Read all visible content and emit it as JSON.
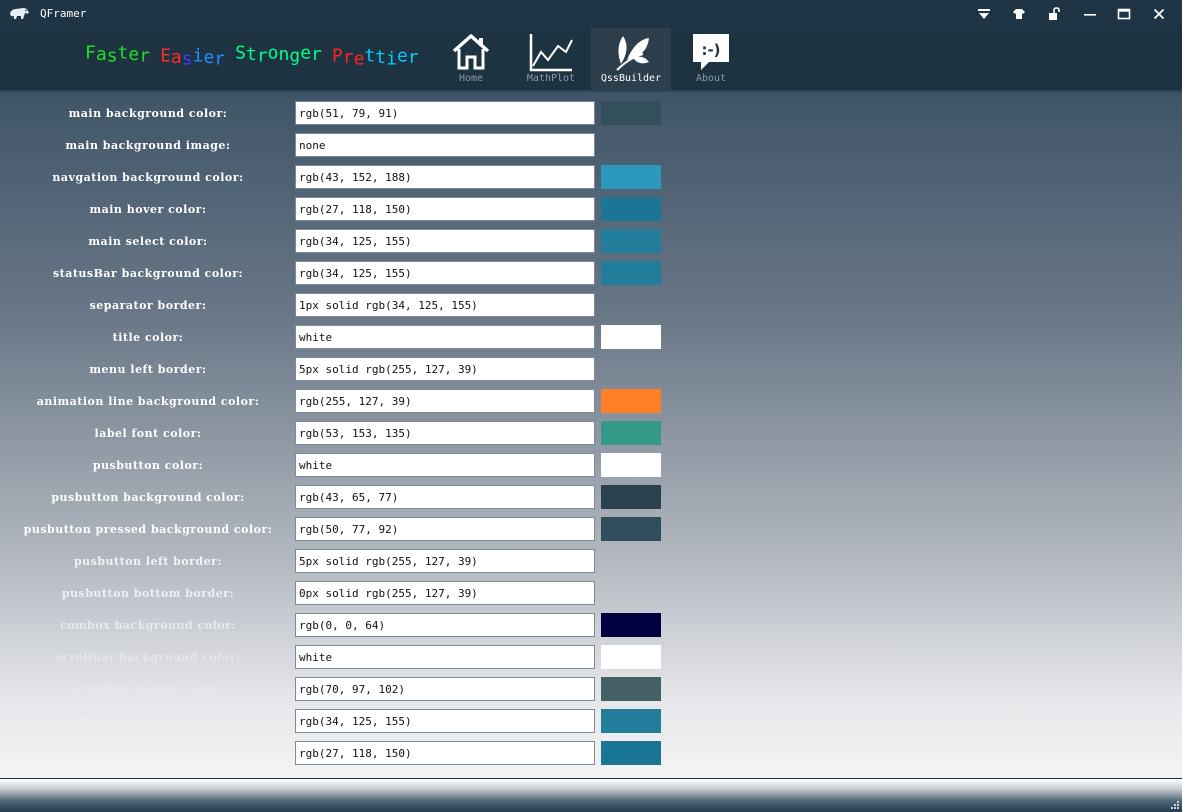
{
  "window": {
    "title": "QFramer",
    "controls": [
      {
        "name": "dropdown-icon",
        "glyph": "▼"
      },
      {
        "name": "skin-shirt-icon",
        "glyph": "shirt"
      },
      {
        "name": "lock-open-icon",
        "glyph": "lock"
      },
      {
        "name": "minimize-icon",
        "glyph": "—"
      },
      {
        "name": "maximize-icon",
        "glyph": "☐"
      },
      {
        "name": "close-icon",
        "glyph": "✕"
      }
    ]
  },
  "slogan": {
    "words": [
      {
        "text": "Faster",
        "colors": [
          "#22dd22"
        ]
      },
      {
        "text": "Easier",
        "colors": [
          "#ff2a2a",
          "#ff2a2a",
          "#3b3bff",
          "#1e90ff",
          "#1e90ff",
          "#1e90ff"
        ]
      },
      {
        "text": "Stronger",
        "colors": [
          "#00ff88"
        ]
      },
      {
        "text": "Prettier",
        "colors": [
          "#ff2222",
          "#ff2222",
          "#ff2222",
          "#00ccff",
          "#00ccff",
          "#00ccff",
          "#00ccff",
          "#00ccff"
        ]
      }
    ]
  },
  "nav": {
    "items": [
      {
        "label": "Home",
        "icon": "home-icon",
        "active": false
      },
      {
        "label": "MathPlot",
        "icon": "line-chart-icon",
        "active": false
      },
      {
        "label": "QssBuilder",
        "icon": "leaf-icon",
        "active": true
      },
      {
        "label": "About",
        "icon": "smiley-bubble-icon",
        "active": false
      }
    ]
  },
  "rows": [
    {
      "label": "main background color:",
      "value": "rgb(51, 79, 91)",
      "swatch": "#334f5b",
      "label_color": "#ffffff"
    },
    {
      "label": "main background image:",
      "value": "none",
      "swatch": null,
      "label_color": "#ffffff"
    },
    {
      "label": "navgation background color:",
      "value": "rgb(43, 152, 188)",
      "swatch": "#2b98bc",
      "label_color": "#ffffff"
    },
    {
      "label": "main hover color:",
      "value": "rgb(27, 118, 150)",
      "swatch": "#1b7696",
      "label_color": "#ffffff"
    },
    {
      "label": "main select color:",
      "value": "rgb(34, 125, 155)",
      "swatch": "#227d9b",
      "label_color": "#ffffff"
    },
    {
      "label": "statusBar background color:",
      "value": "rgb(34, 125, 155)",
      "swatch": "#227d9b",
      "label_color": "#ffffff"
    },
    {
      "label": "separator border:",
      "value": "1px solid rgb(34, 125, 155)",
      "swatch": null,
      "label_color": "#ffffff"
    },
    {
      "label": "title color:",
      "value": "white",
      "swatch": "#ffffff",
      "label_color": "#ffffff"
    },
    {
      "label": "menu left border:",
      "value": "5px solid rgb(255, 127, 39)",
      "swatch": null,
      "label_color": "#ffffff"
    },
    {
      "label": "animation line background color:",
      "value": "rgb(255, 127, 39)",
      "swatch": "#ff7f27",
      "label_color": "#ffffff"
    },
    {
      "label": "label font color:",
      "value": "rgb(53, 153, 135)",
      "swatch": "#359987",
      "label_color": "#ffffff"
    },
    {
      "label": "pusbutton color:",
      "value": "white",
      "swatch": "#ffffff",
      "label_color": "#ffffff"
    },
    {
      "label": "pusbutton background color:",
      "value": "rgb(43, 65, 77)",
      "swatch": "#2b414d",
      "label_color": "#ffffff"
    },
    {
      "label": "pusbutton pressed background color:",
      "value": "rgb(50, 77, 92)",
      "swatch": "#324d5c",
      "label_color": "#ffffff"
    },
    {
      "label": "pusbutton left border:",
      "value": "5px solid rgb(255, 127, 39)",
      "swatch": null,
      "label_color": "#f2f4f6"
    },
    {
      "label": "pusbutton bottom border:",
      "value": "0px solid rgb(255, 127, 39)",
      "swatch": null,
      "label_color": "#eef0f2"
    },
    {
      "label": "combox background color:",
      "value": "rgb(0, 0, 64)",
      "swatch": "#000040",
      "label_color": "#e8eaed"
    },
    {
      "label": "scrollbar background color:",
      "value": "white",
      "swatch": "#ffffff",
      "label_color": "#e4e6e9"
    },
    {
      "label": "scrollbar handle color:",
      "value": "rgb(70, 97, 102)",
      "swatch": "#466166",
      "label_color": "#e6e8ea"
    },
    {
      "label": "headview background color:",
      "value": "rgb(34, 125, 155)",
      "swatch": "#227d9b",
      "label_color": "#eceef0"
    },
    {
      "label": "table or tree background color:",
      "value": "rgb(27, 118, 150)",
      "swatch": "#1b7696",
      "label_color": "#f0f1f3"
    }
  ]
}
